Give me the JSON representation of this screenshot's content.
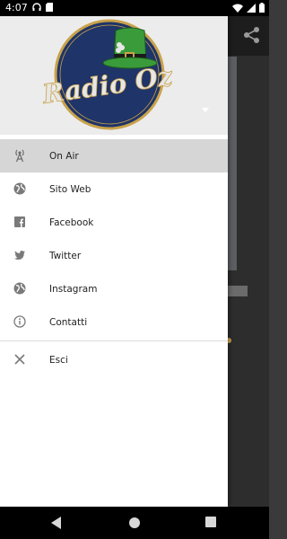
{
  "status_bar": {
    "time": "4:07",
    "left_icons": [
      "headset-icon",
      "sd-card-icon"
    ],
    "right_icons": [
      "wifi-icon",
      "signal-icon",
      "battery-icon"
    ]
  },
  "header": {
    "logo_text": "Radio Oz",
    "account_toggle_icon": "triangle-down-icon"
  },
  "menu": {
    "items": [
      {
        "label": "On Air",
        "icon": "antenna-icon",
        "active": true
      },
      {
        "label": "Sito Web",
        "icon": "globe-icon"
      },
      {
        "label": "Facebook",
        "icon": "facebook-icon"
      },
      {
        "label": "Twitter",
        "icon": "twitter-icon"
      },
      {
        "label": "Instagram",
        "icon": "globe-icon"
      },
      {
        "label": "Contatti",
        "icon": "info-icon"
      }
    ],
    "exit": {
      "label": "Esci",
      "icon": "close-icon"
    }
  },
  "background_toolbar": {
    "share_icon": "share-icon"
  },
  "nav_bar": {
    "buttons": [
      "back-icon",
      "home-icon",
      "recents-icon"
    ]
  },
  "colors": {
    "drawer_header": "#ececec",
    "active_item": "#d6d6d6",
    "logo_navy": "#1f3468",
    "logo_gold": "#c9a24a",
    "hat_green": "#3a9b3a"
  }
}
